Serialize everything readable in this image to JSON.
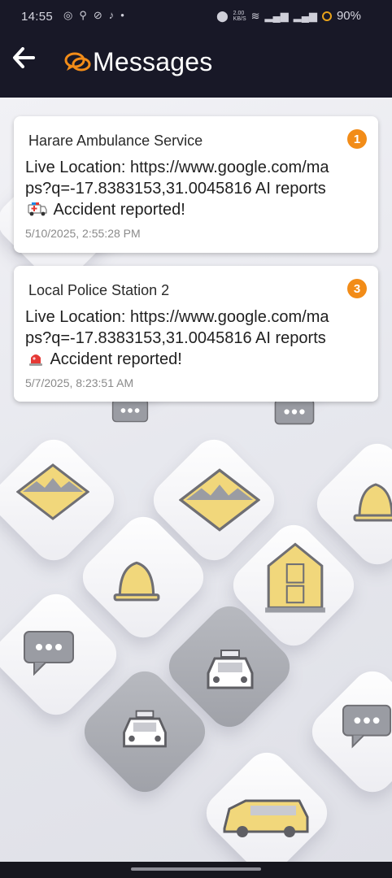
{
  "status_bar": {
    "time": "14:55",
    "speed_top": "2.00",
    "speed_bottom": "KB/S",
    "battery": "90%"
  },
  "header": {
    "title": "Messages",
    "back_icon": "arrow-left-icon",
    "chat_icon": "chat-bubbles-icon",
    "accent": "#f28c18"
  },
  "messages": [
    {
      "sender": "Harare Ambulance Service",
      "badge": "1",
      "text_before": "Live Location: https://www.google.com/maps?q=-17.8383153,31.0045816  AI reports",
      "emoji": "ambulance-icon",
      "text_after": "Accident reported!",
      "timestamp": "5/10/2025, 2:55:28 PM"
    },
    {
      "sender": "Local Police Station 2",
      "badge": "3",
      "text_before": "Live Location: https://www.google.com/maps?q=-17.8383153,31.0045816  AI reports",
      "emoji": "police-light-icon",
      "text_after": "Accident reported!",
      "timestamp": "5/7/2025, 8:23:51 AM"
    }
  ]
}
